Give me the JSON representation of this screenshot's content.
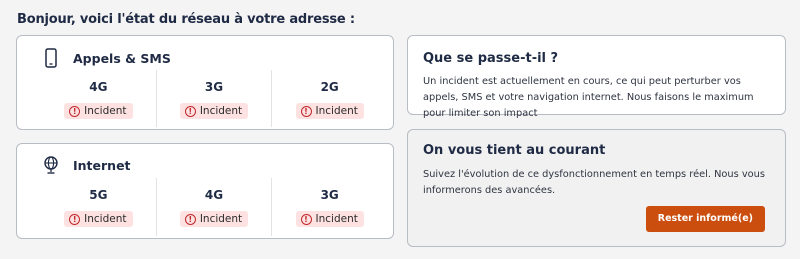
{
  "header": {
    "title": "Bonjour, voici l'état du réseau à votre adresse :"
  },
  "colors": {
    "incident_bg": "#fde2e1",
    "incident_icon": "#c0282d",
    "button": "#cc4e0f"
  },
  "calls_card": {
    "title": "Appels & SMS",
    "icon": "mobile-phone-icon",
    "techs": [
      {
        "name": "4G",
        "status": "Incident"
      },
      {
        "name": "3G",
        "status": "Incident"
      },
      {
        "name": "2G",
        "status": "Incident"
      }
    ]
  },
  "internet_card": {
    "title": "Internet",
    "icon": "globe-icon",
    "techs": [
      {
        "name": "5G",
        "status": "Incident"
      },
      {
        "name": "4G",
        "status": "Incident"
      },
      {
        "name": "3G",
        "status": "Incident"
      }
    ]
  },
  "info_card": {
    "title": "Que se passe-t-il ?",
    "text": "Un incident est actuellement en cours, ce qui peut perturber vos appels, SMS et votre navigation internet. Nous faisons le maximum pour limiter son impact"
  },
  "updates_card": {
    "title": "On vous tient au courant",
    "text": "Suivez l'évolution de ce dysfonctionnement en temps réel. Nous vous informerons des avancées.",
    "button_label": "Rester informé(e)"
  }
}
